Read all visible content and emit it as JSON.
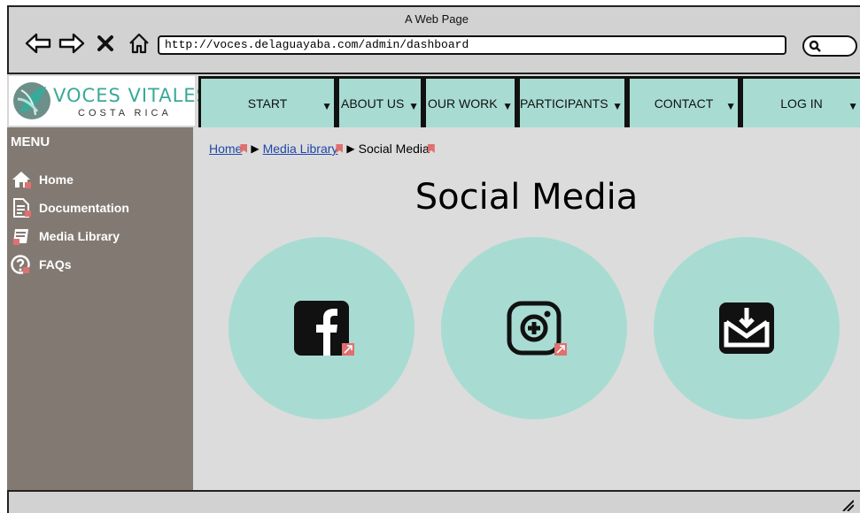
{
  "browser": {
    "window_title": "A Web Page",
    "url": "http://voces.delaguayaba.com/admin/dashboard",
    "nav_icons": [
      "back-arrow-icon",
      "forward-arrow-icon",
      "close-x-icon",
      "home-icon"
    ],
    "search_icon": "search-icon"
  },
  "logo": {
    "title": "VOCES VITALES",
    "subtitle": "COSTA RICA",
    "accent_color": "#39a99a"
  },
  "nav": {
    "items": [
      {
        "label": "START",
        "has_dropdown": true
      },
      {
        "label": "ABOUT US",
        "has_dropdown": true
      },
      {
        "label": "OUR WORK",
        "has_dropdown": true
      },
      {
        "label": "PARTICIPANTS",
        "has_dropdown": true
      },
      {
        "label": "CONTACT",
        "has_dropdown": true
      },
      {
        "label": "LOG IN",
        "has_dropdown": true
      }
    ],
    "caret": "▼",
    "button_color": "#a8dcd2"
  },
  "sidebar": {
    "title": "MENU",
    "items": [
      {
        "label": "Home",
        "icon": "home-icon"
      },
      {
        "label": "Documentation",
        "icon": "document-icon"
      },
      {
        "label": "Media Library",
        "icon": "book-icon"
      },
      {
        "label": "FAQs",
        "icon": "question-icon"
      }
    ],
    "background": "#827a72"
  },
  "breadcrumb": {
    "items": [
      {
        "label": "Home",
        "link": true
      },
      {
        "label": "Media Library",
        "link": true
      },
      {
        "label": "Social Media",
        "link": false
      }
    ]
  },
  "page": {
    "title": "Social Media",
    "social_links": [
      {
        "icon": "facebook-icon",
        "external": true
      },
      {
        "icon": "instagram-icon",
        "external": true
      },
      {
        "icon": "email-icon",
        "external": false
      }
    ]
  }
}
